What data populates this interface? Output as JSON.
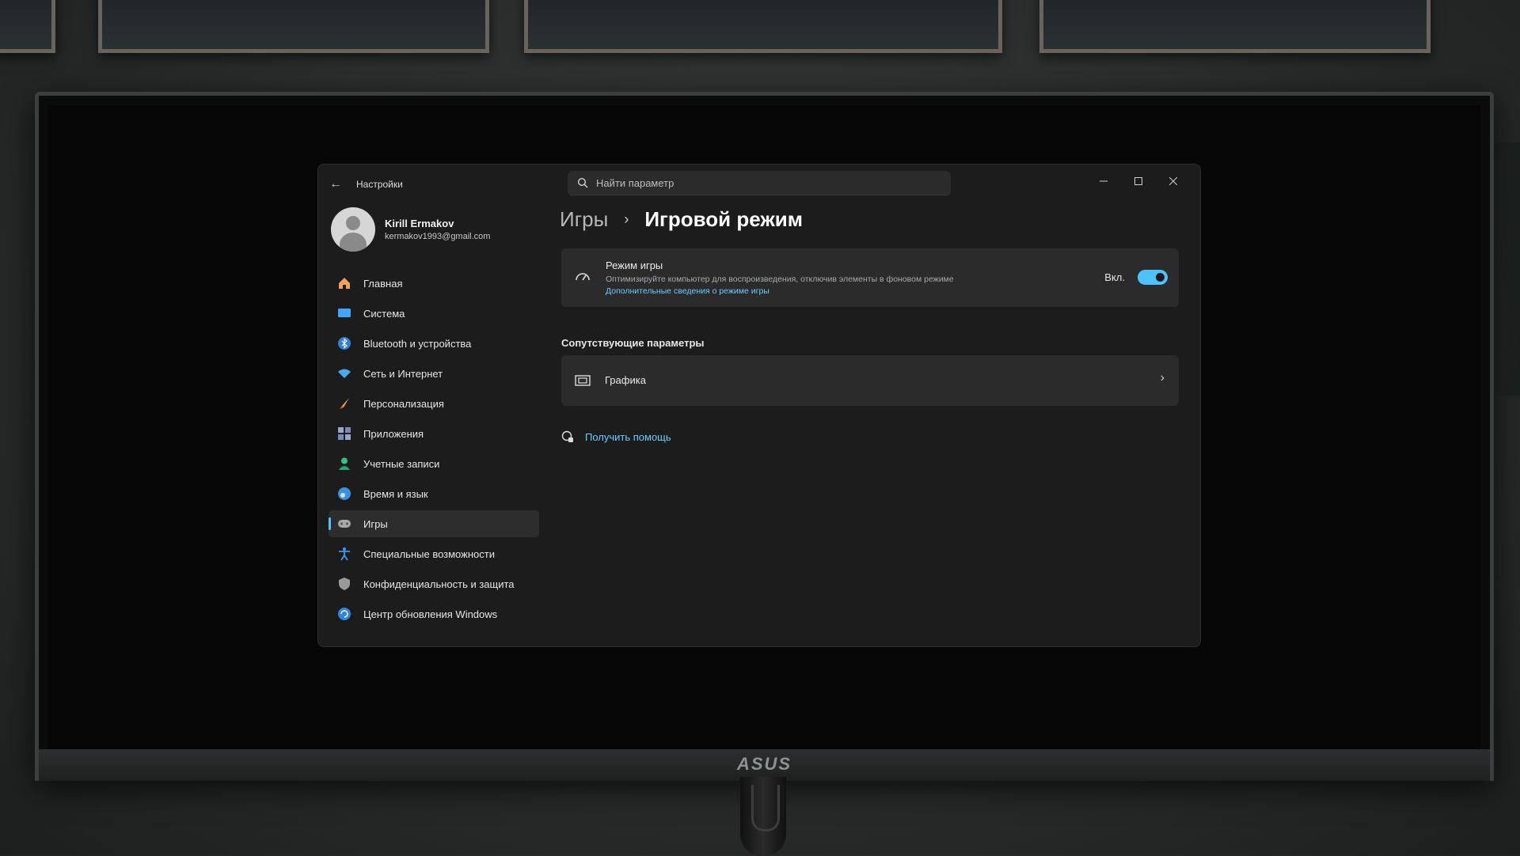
{
  "window": {
    "app_title": "Настройки",
    "search_placeholder": "Найти параметр"
  },
  "profile": {
    "name": "Kirill Ermakov",
    "email": "kermakov1993@gmail.com"
  },
  "sidebar": {
    "items": [
      {
        "label": "Главная",
        "icon": "home-icon"
      },
      {
        "label": "Система",
        "icon": "display-icon"
      },
      {
        "label": "Bluetooth и устройства",
        "icon": "bluetooth-icon"
      },
      {
        "label": "Сеть и Интернет",
        "icon": "wifi-icon"
      },
      {
        "label": "Персонализация",
        "icon": "brush-icon"
      },
      {
        "label": "Приложения",
        "icon": "apps-icon"
      },
      {
        "label": "Учетные записи",
        "icon": "person-icon"
      },
      {
        "label": "Время и язык",
        "icon": "globe-icon"
      },
      {
        "label": "Игры",
        "icon": "gamepad-icon",
        "active": true
      },
      {
        "label": "Специальные возможности",
        "icon": "accessibility-icon"
      },
      {
        "label": "Конфиденциальность и защита",
        "icon": "shield-icon"
      },
      {
        "label": "Центр обновления Windows",
        "icon": "update-icon"
      }
    ]
  },
  "breadcrumb": {
    "parent": "Игры",
    "separator": "›",
    "current": "Игровой режим"
  },
  "game_mode": {
    "title": "Режим игры",
    "description": "Оптимизируйте компьютер для воспроизведения, отключив элементы в фоновом режиме",
    "link": "Дополнительные сведения о режиме игры",
    "toggle_label": "Вкл.",
    "enabled": true
  },
  "related": {
    "section_title": "Сопутствующие параметры",
    "graphics_label": "Графика"
  },
  "help": {
    "label": "Получить помощь"
  },
  "monitor": {
    "brand": "ASUS"
  },
  "colors": {
    "accent": "#4cc2ff",
    "window_bg": "#1c1c1c",
    "card_bg": "#2b2b2b"
  }
}
